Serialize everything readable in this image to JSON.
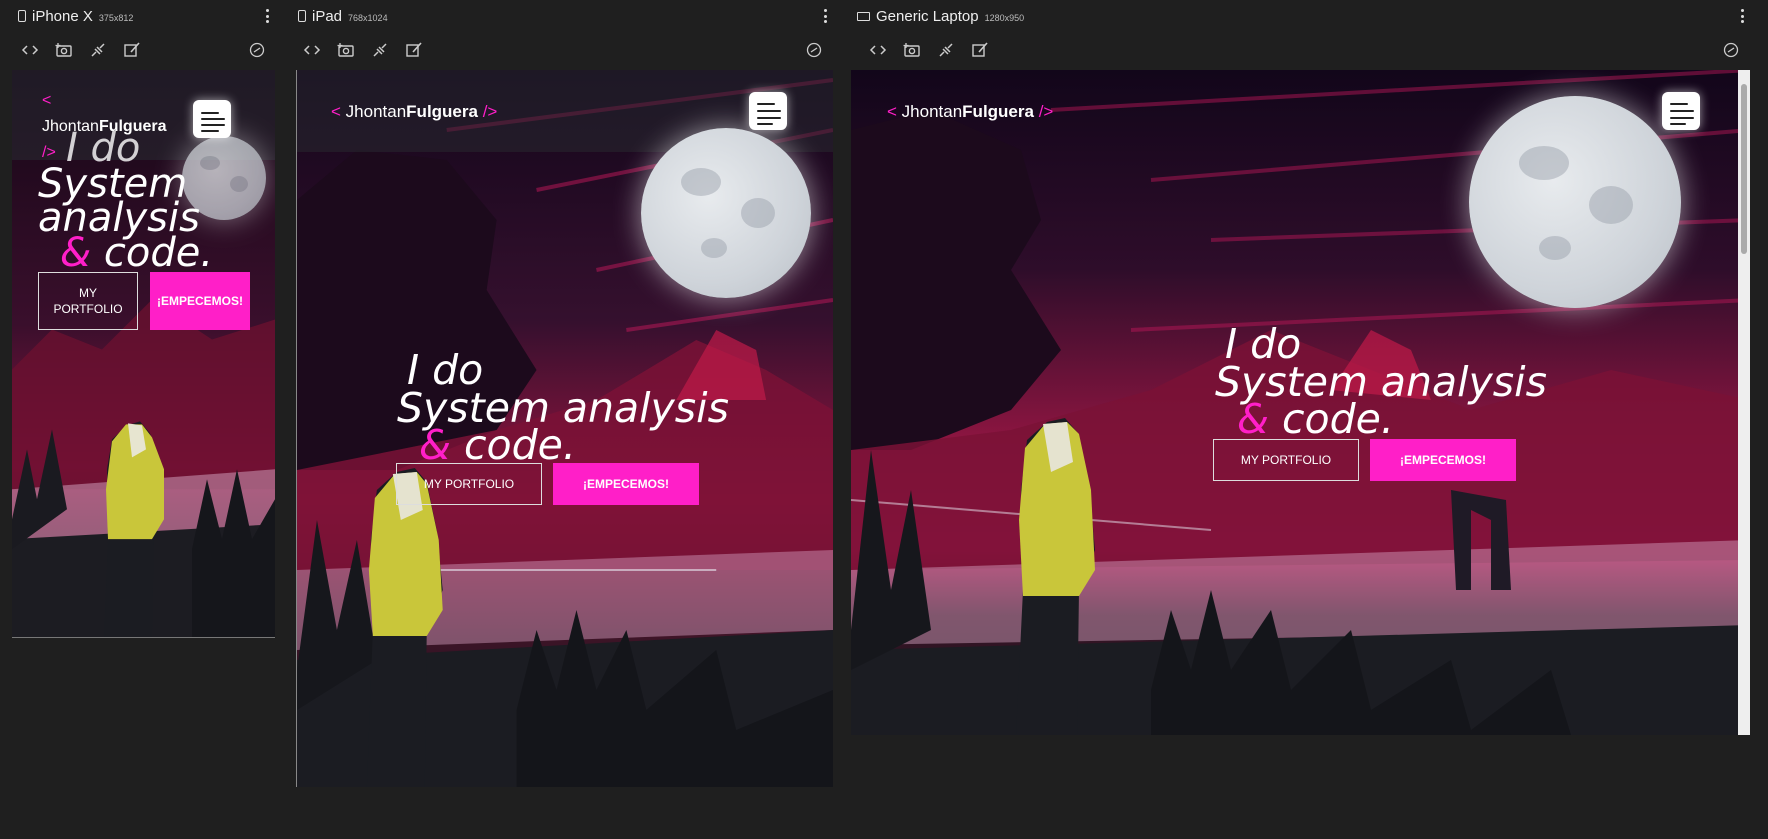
{
  "panels": [
    {
      "id": "iphone",
      "device_name": "iPhone X",
      "resolution": "375x812"
    },
    {
      "id": "ipad",
      "device_name": "iPad",
      "resolution": "768x1024"
    },
    {
      "id": "laptop",
      "device_name": "Generic Laptop",
      "resolution": "1280x950"
    }
  ],
  "toolbar_icons": [
    "code-icon",
    "screenshot-icon",
    "plug-icon",
    "edit-icon",
    "rotate-icon"
  ],
  "site": {
    "logo_open": "<",
    "logo_first": "Jhontan",
    "logo_last": "Fulguera",
    "logo_close": "/>",
    "hero_line1": "I do",
    "hero_line2": "System analysis",
    "hero_amp": "&",
    "hero_line3": " code.",
    "portfolio_label": "MY PORTFOLIO",
    "start_label": "¡EMPECEMOS!",
    "accent_color": "#ff1fc8"
  }
}
